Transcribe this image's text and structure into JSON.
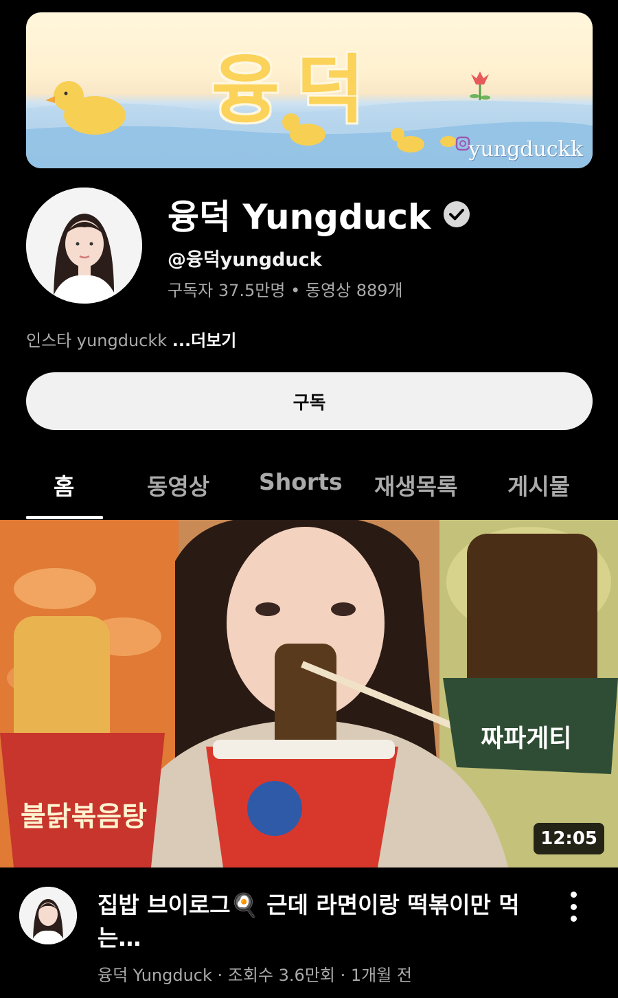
{
  "banner": {
    "title": "융덕",
    "handle": "yungduckk"
  },
  "channel": {
    "name": "융덕 Yungduck",
    "handle": "@융덕yungduck",
    "stats": "구독자 37.5만명 • 동영상 889개",
    "description": "인스타 yungduckk ",
    "more_label": "...더보기",
    "subscribe_label": "구독"
  },
  "tabs": [
    {
      "label": "홈",
      "active": true
    },
    {
      "label": "동영상",
      "active": false
    },
    {
      "label": "Shorts",
      "active": false
    },
    {
      "label": "재생목록",
      "active": false
    },
    {
      "label": "게시물",
      "active": false
    }
  ],
  "video": {
    "title": "집밥 브이로그🍳 근데 라면이랑 떡볶이만 먹는…",
    "meta": "융덕 Yungduck · 조회수 3.6만회 · 1개월 전",
    "duration": "12:05",
    "thumb_text_1": "불닭볶음탕",
    "thumb_text_2": "짜파게티"
  },
  "colors": {
    "background": "#000000",
    "secondary_text": "#aaaaaa",
    "subscribe_bg": "#f1f1f1"
  }
}
